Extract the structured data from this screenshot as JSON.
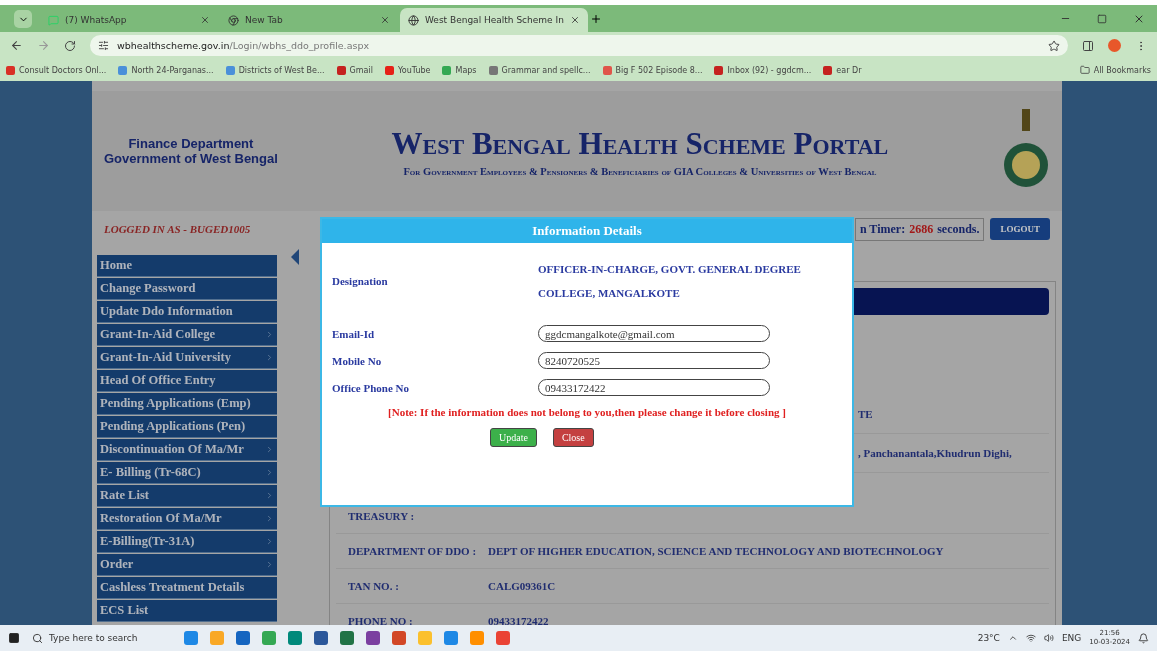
{
  "browser": {
    "tabs": [
      {
        "label": "(7) WhatsApp",
        "selected": false
      },
      {
        "label": "New Tab",
        "selected": false
      },
      {
        "label": "West Bengal Health Scheme In",
        "selected": true
      }
    ],
    "url": {
      "domain": "wbhealthscheme.gov.in",
      "path": "/Login/wbhs_ddo_profile.aspx"
    },
    "bookmarks": [
      {
        "label": "Consult Doctors Onl...",
        "color": "#d93025"
      },
      {
        "label": "North 24-Parganas...",
        "color": "#4a90d9"
      },
      {
        "label": "Districts of West Be...",
        "color": "#4a90d9"
      },
      {
        "label": "Gmail",
        "color": "#c5221f"
      },
      {
        "label": "YouTube",
        "color": "#e62117"
      },
      {
        "label": "Maps",
        "color": "#34a853"
      },
      {
        "label": "Grammar and spellc...",
        "color": "#777777"
      },
      {
        "label": "Big F 502 Episode 8...",
        "color": "#e0554a"
      },
      {
        "label": "Inbox (92) - ggdcm...",
        "color": "#c5221f"
      },
      {
        "label": "ear Dr",
        "color": "#c5221f"
      }
    ],
    "all_bookmarks": "All Bookmarks"
  },
  "header": {
    "dept_line1": "Finance Department",
    "dept_line2": "Government of West Bengal",
    "title": "West Bengal Health Scheme Portal",
    "subtitle": "For Government Employees & Pensioners & Beneficiaries of GIA Colleges & Universities of West Bengal"
  },
  "logged_in": "LOGGED IN AS - BUGED1005",
  "timer": {
    "label": "n Timer:",
    "value": "2686",
    "unit": "seconds."
  },
  "logout": "LOGOUT",
  "sidebar": [
    {
      "label": "Home",
      "has_submenu": false
    },
    {
      "label": "Change Password",
      "has_submenu": false
    },
    {
      "label": "Update Ddo Information",
      "has_submenu": false
    },
    {
      "label": "Grant-In-Aid College",
      "has_submenu": true
    },
    {
      "label": "Grant-In-Aid University",
      "has_submenu": true
    },
    {
      "label": "Head Of Office Entry",
      "has_submenu": false
    },
    {
      "label": "Pending Applications (Emp)",
      "has_submenu": false
    },
    {
      "label": "Pending Applications (Pen)",
      "has_submenu": false
    },
    {
      "label": "Discontinuation Of Ma/Mr",
      "has_submenu": true
    },
    {
      "label": "E- Billing (Tr-68C)",
      "has_submenu": true
    },
    {
      "label": "Rate List",
      "has_submenu": true
    },
    {
      "label": "Restoration Of Ma/Mr",
      "has_submenu": true
    },
    {
      "label": "E-Billing(Tr-31A)",
      "has_submenu": true
    },
    {
      "label": "Order",
      "has_submenu": true
    },
    {
      "label": "Cashless Treatment Details",
      "has_submenu": false
    },
    {
      "label": "ECS List",
      "has_submenu": false
    }
  ],
  "details": [
    {
      "kind": "partial",
      "value": "TE"
    },
    {
      "kind": "partial",
      "value": ", Panchanantala,Khudrun Dighi,"
    },
    {
      "kind": "row",
      "label": "TREASURY :"
    },
    {
      "kind": "row",
      "label": "DEPARTMENT OF DDO :",
      "value": "DEPT OF HIGHER EDUCATION, SCIENCE AND TECHNOLOGY AND BIOTECHNOLOGY"
    },
    {
      "kind": "row",
      "label": "TAN NO. :",
      "value": "CALG09361C"
    },
    {
      "kind": "row",
      "label": "PHONE NO :",
      "value": "09433172422"
    }
  ],
  "modal": {
    "title": "Information Details",
    "designation_label": "Designation",
    "designation": "OFFICER-IN-CHARGE, GOVT. GENERAL DEGREE COLLEGE, MANGALKOTE",
    "fields": [
      {
        "label": "Email-Id",
        "value": "ggdcmangalkote@gmail.com"
      },
      {
        "label": "Mobile No",
        "value": "8240720525"
      },
      {
        "label": "Office Phone No",
        "value": "09433172422"
      }
    ],
    "note": "[Note: If the information does not belong to you,then please change it before closing ]",
    "buttons": [
      {
        "label": "Update",
        "kind": "update"
      },
      {
        "label": "Close",
        "kind": "close"
      }
    ]
  },
  "taskbar": {
    "search_placeholder": "Type here to search",
    "weather": "23°C",
    "lang": "ENG",
    "time": "21:56",
    "date": "10-03-2024"
  }
}
